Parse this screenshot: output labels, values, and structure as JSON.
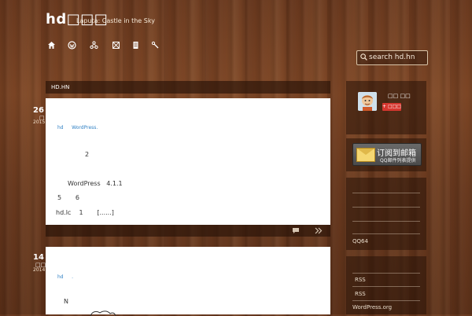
{
  "header": {
    "site_title": "hd□□□",
    "site_description": "Laputa: Castle in the Sky",
    "nav_icons": [
      "home-icon",
      "wordpress-icon",
      "share-icon",
      "grid-icon",
      "document-icon",
      "tools-icon"
    ]
  },
  "search": {
    "placeholder": "search hd.hn"
  },
  "breadcrumb": {
    "label": "HD.HN"
  },
  "posts": [
    {
      "day": "26",
      "month": "□",
      "year": "2015",
      "tags": [
        "hd",
        "WordPress."
      ],
      "lines": [
        "2",
        "WordPress   4.1.1",
        "5       6",
        "hd.lc    1       [......]"
      ]
    },
    {
      "day": "14",
      "month": "□□",
      "year": "2014",
      "tags": [
        "hd",
        "."
      ],
      "lines": [
        "N"
      ]
    }
  ],
  "sidebar": {
    "profile": {
      "name": "□□ □□",
      "follow_label": "+ □□□"
    },
    "subscribe": {
      "title": "订阅到邮箱",
      "subtitle": "QQ邮件列表提供"
    },
    "links_footer": "QQ64",
    "meta_links": [
      "RSS",
      "RSS",
      "WordPress.org"
    ]
  },
  "colors": {
    "link": "#2f80c4",
    "follow_button": "#d7372f",
    "wood": "#6b3a1f"
  }
}
